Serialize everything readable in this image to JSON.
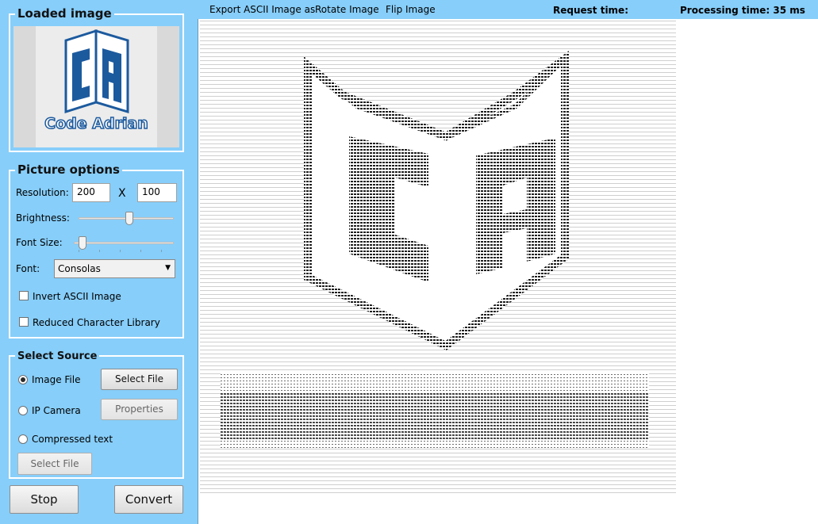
{
  "loaded_image": {
    "group_title": "Loaded image",
    "logo_text": "Code Adrian"
  },
  "picture_options": {
    "group_title": "Picture options",
    "resolution_label": "Resolution:",
    "resolution_width": "200",
    "resolution_sep": "X",
    "resolution_height": "100",
    "brightness_label": "Brightness:",
    "brightness_value": 0.5,
    "font_size_label": "Font Size:",
    "font_size_value": 0.05,
    "font_label": "Font:",
    "font_selected": "Consolas",
    "invert_label": "Invert ASCII Image",
    "invert_checked": false,
    "reduced_label": "Reduced Character Library",
    "reduced_checked": false
  },
  "select_source": {
    "group_title": "Select Source",
    "image_file_label": "Image File",
    "image_file_selected": true,
    "select_file_label": "Select File",
    "ip_camera_label": "IP Camera",
    "properties_label": "Properties",
    "compressed_text_label": "Compressed text",
    "compressed_select_file_label": "Select File"
  },
  "actions": {
    "stop_label": "Stop",
    "convert_label": "Convert"
  },
  "menu": {
    "export_label": "Export ASCII Image as",
    "rotate_label": "Rotate Image",
    "flip_label": "Flip Image"
  },
  "status": {
    "request_time_label": "Request time:",
    "processing_time_label": "Processing time: 35 ms"
  },
  "colors": {
    "background": "#87cefa",
    "logo_blue": "#1c5a9e"
  }
}
